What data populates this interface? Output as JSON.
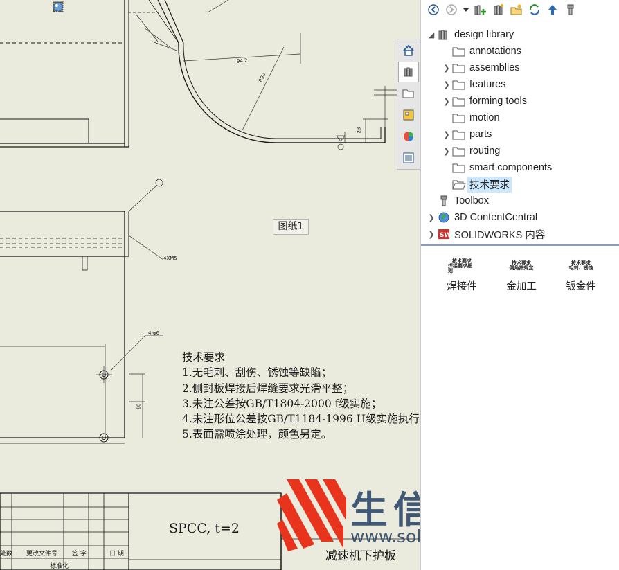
{
  "drawing": {
    "sheet_label": "图纸1",
    "notes_title": "技术要求",
    "notes": [
      "1.无毛刺、刮伤、锈蚀等缺陷；",
      "2.侧封板焊接后焊缝要求光滑平整；",
      "3.未注公差按GB/T1804-2000 f级实施；",
      "4.未注形位公差按GB/T1184-1996 H级实施执行",
      "5.表面需喷涂处理，颜色另定。"
    ],
    "title_block": {
      "material": "SPCC, t=2",
      "part_name": "减速机下护板",
      "labels": [
        "处数",
        "更改文件号",
        "签 字",
        "日 期",
        "标准化"
      ]
    },
    "dims": {
      "d1": "94.2",
      "d2": "R90",
      "d3": "23",
      "d4": "4XM5",
      "d5": "4-φ6",
      "d6": "10"
    },
    "toolbar_icons": [
      "zoom-to-fit-icon",
      "zoom-to-area-icon",
      "zoom-in-out-icon",
      "select-icon",
      "rotate-icon",
      "pan-icon",
      "view-orientation-icon",
      "display-style-icon",
      "appearance-icon"
    ]
  },
  "watermark": {
    "company": "生信科技",
    "url": "www.solidwise.com"
  },
  "task_pane": {
    "tabs": [
      "home-icon",
      "design-library-icon",
      "file-explorer-icon",
      "view-palette-icon",
      "appearances-icon",
      "custom-properties-icon"
    ],
    "toolbar": [
      "back-icon",
      "forward-icon",
      "dropdown-icon",
      "add-to-library-icon",
      "add-file-location-icon",
      "create-new-folder-icon",
      "refresh-icon",
      "up-one-level-icon",
      "toolbox-icon"
    ],
    "tree": {
      "root": "design library",
      "children": [
        {
          "label": "annotations",
          "expandable": false
        },
        {
          "label": "assemblies",
          "expandable": true
        },
        {
          "label": "features",
          "expandable": true
        },
        {
          "label": "forming tools",
          "expandable": true
        },
        {
          "label": "motion",
          "expandable": false
        },
        {
          "label": "parts",
          "expandable": true
        },
        {
          "label": "routing",
          "expandable": true
        },
        {
          "label": "smart components",
          "expandable": false
        },
        {
          "label": "技术要求",
          "expandable": false,
          "selected": true
        }
      ],
      "toolbox": "Toolbox",
      "content_central": "3D ContentCentral",
      "sw_content": "SOLIDWORKS 内容"
    },
    "items": [
      {
        "label": "焊接件",
        "preview": [
          "技术要求",
          "焊接要求细则"
        ]
      },
      {
        "label": "金加工",
        "preview": [
          "技术要求",
          "倒角按规定"
        ]
      },
      {
        "label": "钣金件",
        "preview": [
          "技术要求",
          "毛刺、锈蚀"
        ]
      }
    ]
  }
}
